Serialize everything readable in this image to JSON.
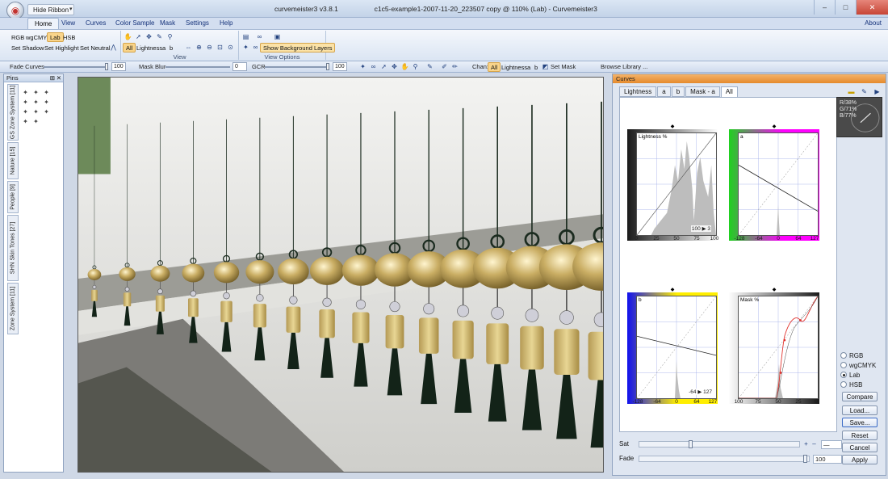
{
  "window": {
    "title_left": "curvemeister3 v3.8.1",
    "title_doc": "c1c5-example1-2007-11-20_223507 copy @ 110% (Lab) - Curvemeister3",
    "hide_ribbon": "Hide Ribbon"
  },
  "ribbon_tabs": [
    "Home",
    "View",
    "Curves",
    "Color Sample",
    "Mask",
    "Settings",
    "Help"
  ],
  "about": "About",
  "ribbon": {
    "color_modes": [
      "RGB",
      "wgCMYK",
      "Lab",
      "HSB"
    ],
    "set_buttons": [
      "Set Shadow",
      "Set Highlight",
      "Set Neutral"
    ],
    "channels": [
      "All",
      "Lightness",
      "a",
      "b"
    ],
    "group_view": "View",
    "group_view_options": "View Options",
    "show_background_layers": "Show Background Layers"
  },
  "toolstrip": {
    "fade_curves": "Fade Curves",
    "fade_curves_value": "100",
    "mask_blur": "Mask Blur",
    "mask_blur_value": "0",
    "gcr": "GCR",
    "gcr_value": "100",
    "chan_label": "Chan:",
    "chan_items": [
      "All",
      "Lightness",
      "a",
      "b"
    ],
    "set_mask": "Set Mask",
    "browse_library": "Browse Library ..."
  },
  "pins_panel": {
    "title": "Pins",
    "tabs": [
      "GS Zone System [11]",
      "Nature [15]",
      "People [9]",
      "SHN Skin Tones [27]",
      "Zone System [11]"
    ]
  },
  "curves_panel": {
    "title": "Curves",
    "tabs": [
      "Lightness",
      "a",
      "b",
      "Mask - a",
      "All"
    ],
    "graphs": {
      "lightness": {
        "name": "Lightness %",
        "ticks": [
          "0",
          "25",
          "50",
          "75",
          "100"
        ],
        "readout": "100 ▶ 3"
      },
      "a": {
        "name": "a",
        "ticks": [
          "-128",
          "-64",
          "0",
          "64",
          "127"
        ]
      },
      "b": {
        "name": "b",
        "ticks": [
          "-128",
          "-64",
          "0",
          "64",
          "127"
        ],
        "readout": "-64 ▶ 127"
      },
      "mask": {
        "name": "Mask %",
        "ticks": [
          "100",
          "75",
          "50",
          "25",
          "0"
        ]
      }
    },
    "readout": {
      "r": "R/38%",
      "g": "G/71%",
      "b": "B/77%"
    },
    "sat": {
      "label": "Sat",
      "value": "—"
    },
    "fade": {
      "label": "Fade",
      "value": "100"
    }
  },
  "side_controls": {
    "radios": [
      "RGB",
      "wgCMYK",
      "Lab",
      "HSB"
    ],
    "selected": "Lab",
    "buttons": [
      "Compare",
      "Load...",
      "Save...",
      "Reset",
      "Cancel",
      "Apply"
    ]
  }
}
